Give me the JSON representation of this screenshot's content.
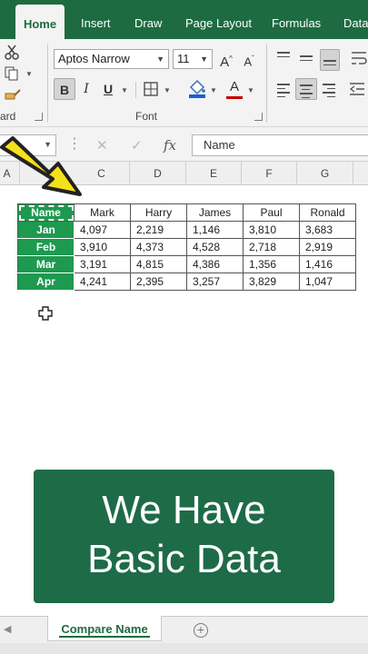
{
  "ribbon_tabs": [
    "Home",
    "Insert",
    "Draw",
    "Page Layout",
    "Formulas",
    "Data"
  ],
  "active_tab": "Home",
  "clipboard": {
    "label": "ard"
  },
  "font": {
    "label": "Font",
    "name": "Aptos Narrow",
    "size": "11",
    "grow": "A",
    "shrink": "A",
    "bold": "B",
    "italic": "I",
    "underline": "U",
    "font_color": "A",
    "icons": [
      "bold-icon",
      "italic-icon",
      "underline-icon",
      "borders-icon",
      "fill-color-icon",
      "font-color-icon"
    ]
  },
  "formula_bar": {
    "cancel": "✕",
    "enter": "✓",
    "fx": "fx",
    "content": "Name"
  },
  "columns": [
    "A",
    "C",
    "D",
    "E",
    "F",
    "G"
  ],
  "table": {
    "header": [
      "Name",
      "Mark",
      "Harry",
      "James",
      "Paul",
      "Ronald"
    ],
    "rows": [
      [
        "Jan",
        "4,097",
        "2,219",
        "1,146",
        "3,810",
        "3,683"
      ],
      [
        "Feb",
        "3,910",
        "4,373",
        "4,528",
        "2,718",
        "2,919"
      ],
      [
        "Mar",
        "3,191",
        "4,815",
        "4,386",
        "1,356",
        "1,416"
      ],
      [
        "Apr",
        "4,241",
        "2,395",
        "3,257",
        "3,829",
        "1,047"
      ]
    ]
  },
  "caption": {
    "line1": "We Have",
    "line2": "Basic Data"
  },
  "sheet_tab": "Compare Name",
  "add_sheet": "+",
  "colors": {
    "ribbon": "#1e6b41",
    "table_green": "#1d9a4f",
    "caption_bg": "#1e6b48",
    "arrow": "#f5e11a"
  }
}
